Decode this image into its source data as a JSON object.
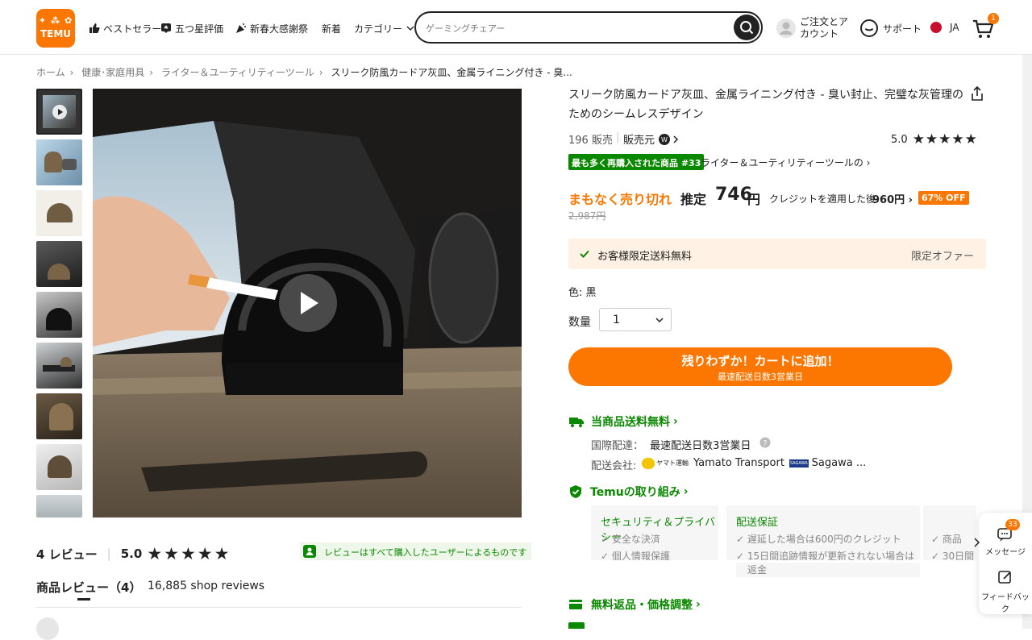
{
  "header": {
    "logo_top": "✦ ⁂ ✿",
    "logo_text": "TEMU",
    "nav": [
      "ベストセラー",
      "五つ星評価",
      "新春大感謝祭",
      "新着",
      "カテゴリー"
    ],
    "search_placeholder": "ゲーミングチェアー",
    "account_line1": "ご注文とア",
    "account_line2": "カウント",
    "support": "サポート",
    "lang": "JA",
    "cart_count": "1"
  },
  "breadcrumb": [
    "ホーム",
    "健康･家庭用具",
    "ライター＆ユーティリティーツール",
    "スリーク防風カードア灰皿、金属ライニング付き - 臭..."
  ],
  "product": {
    "title": "スリーク防風カードア灰皿、金属ライニング付き - 臭い封止、完璧な灰管理のためのシームレスデザイン",
    "sold": "196 販売",
    "seller_label": "販売元",
    "rating": "5.0",
    "rank_badge": "最も多く再購入された商品 #33",
    "rank_category": "ライター＆ユーティリティーツールの",
    "urgency": "まもなく売り切れ",
    "est_label": "推定",
    "price_big": "746",
    "price_unit": "円",
    "credit_text": "クレジットを適用した後",
    "credit_price": "960円",
    "discount": "67% OFF",
    "orig_price": "2,987円",
    "free_ship": "お客様限定送料無料",
    "limited_offer": "限定オファー",
    "color_label": "色: 黒",
    "qty_label": "数量",
    "qty_value": "1",
    "cart_button": "残りわずか！カートに追加！",
    "cart_sub": "最速配送日数3営業日"
  },
  "shipping": {
    "heading": "当商品送料無料",
    "intl_label": "国際配達：",
    "intl_value": "最速配送日数3営業日",
    "carrier_label": "配送会社:",
    "carrier1_logo": "ヤマト運輸",
    "carrier1": "Yamato Transport",
    "carrier2_logo": "SAGAWA",
    "carrier2": "Sagawa ..."
  },
  "commitment": {
    "heading": "Temuの取り組み",
    "card1_title": "セキュリティ＆プライバシー",
    "card1_items": [
      "安全な決済",
      "個人情報保護"
    ],
    "card2_title": "配送保証",
    "card2_items": [
      "遅延した場合は600円のクレジット",
      "15日間追跡情報が更新されない場合は",
      "返金"
    ],
    "card3_items": [
      "商品",
      "30日間"
    ]
  },
  "returns_heading": "無料返品・価格調整",
  "float": {
    "messages": "メッセージ",
    "msg_count": "33",
    "feedback": "フィードバック"
  },
  "reviews": {
    "count_label": "4 レビュー",
    "rating": "5.0",
    "verified_text": "レビューはすべて購入したユーザーによるものです",
    "tab_label": "商品レビュー（4）",
    "shop_reviews": "16,885 shop reviews"
  },
  "colors": {
    "accent": "#fb7701",
    "green": "#0a8800"
  }
}
